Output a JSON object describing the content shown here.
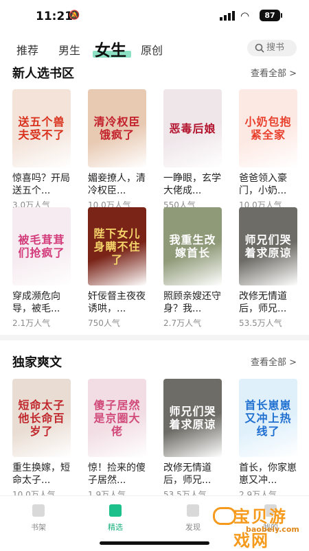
{
  "status": {
    "time": "11:21",
    "battery": "87"
  },
  "tabs": [
    {
      "label": "推荐"
    },
    {
      "label": "男生"
    },
    {
      "label": "女生"
    },
    {
      "label": "原创"
    }
  ],
  "search": {
    "label": "搜书"
  },
  "sections": [
    {
      "title": "新人选书区",
      "more": "查看全部 >",
      "books": [
        {
          "title": "惊喜吗？开局送五个...",
          "pop": "3.0万人气",
          "cover_text": "送五个兽夫受不了",
          "bg": "#f3e3d9",
          "fg": "#d9301c"
        },
        {
          "title": "媚妾撩人，清冷权臣...",
          "pop": "10.0万人气",
          "cover_text": "清冷权臣饿疯了",
          "bg": "#e8c9b2",
          "fg": "#c2202b"
        },
        {
          "title": "一睁眼，玄学大佬成...",
          "pop": "550人气",
          "cover_text": "恶毒后娘",
          "bg": "#efe6ea",
          "fg": "#b3122c"
        },
        {
          "title": "爸爸领入豪门，小奶...",
          "pop": "10.0万人气",
          "cover_text": "小奶包抱紧全家",
          "bg": "#fde9e3",
          "fg": "#e8402c"
        },
        {
          "title": "穿成濒危向导，被毛...",
          "pop": "2.1万人气",
          "cover_text": "被毛茸茸们抢疯了",
          "bg": "#f6ebf0",
          "fg": "#d23a7a"
        },
        {
          "title": "奸佞督主夜夜诱哄，...",
          "pop": "750人气",
          "cover_text": "陛下女儿身瞒不住了",
          "bg": "#7a2418",
          "fg": "#f5d56a"
        },
        {
          "title": "照顾亲嫂还守身？我...",
          "pop": "2.7万人气",
          "cover_text": "我重生改嫁首长",
          "bg": "#8f9a78",
          "fg": "#ffffff"
        },
        {
          "title": "改修无情道后，师兄...",
          "pop": "53.5万人气",
          "cover_text": "师兄们哭着求原谅",
          "bg": "#6d6c66",
          "fg": "#ffffff"
        }
      ]
    },
    {
      "title": "独家爽文",
      "more": "查看全部 >",
      "books": [
        {
          "title": "重生换嫁，短命太子...",
          "pop": "10.0万人气",
          "cover_text": "短命太子他长命百岁了",
          "bg": "#e9dcd2",
          "fg": "#c0272d"
        },
        {
          "title": "惊！捡来的傻子居然...",
          "pop": "1.9万人气",
          "cover_text": "傻子居然是京圈大佬",
          "bg": "#f1dde3",
          "fg": "#d14a7a"
        },
        {
          "title": "改修无情道后，师兄...",
          "pop": "53.5万人气",
          "cover_text": "师兄们哭着求原谅",
          "bg": "#6d6c66",
          "fg": "#ffffff"
        },
        {
          "title": "首长，你家崽崽又冲...",
          "pop": "2.9万人气",
          "cover_text": "首长崽崽又冲上热线了",
          "bg": "#dff0fb",
          "fg": "#1f6fd1"
        }
      ]
    }
  ],
  "bottom_nav": [
    {
      "label": "书架"
    },
    {
      "label": "精选"
    },
    {
      "label": "发现"
    },
    {
      "label": "我的"
    }
  ],
  "watermark": {
    "title": "宝贝游戏网",
    "domain": "baobeiy.com"
  }
}
